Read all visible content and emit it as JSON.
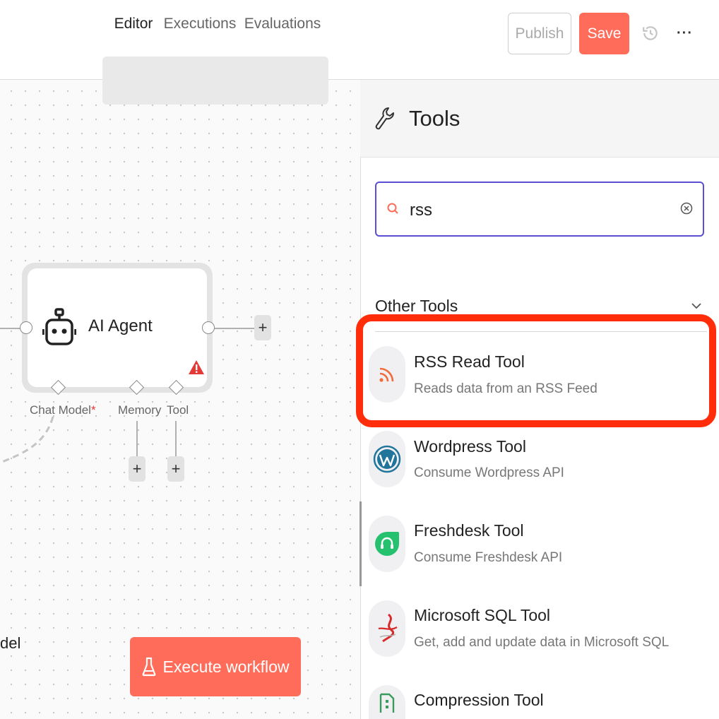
{
  "topbar": {
    "publish_label": "Publish",
    "save_label": "Save",
    "history_icon": "history-icon",
    "more_label": "···"
  },
  "tabs": [
    {
      "label": "Editor",
      "active": true
    },
    {
      "label": "Executions",
      "active": false
    },
    {
      "label": "Evaluations",
      "active": false
    }
  ],
  "canvas": {
    "node": {
      "title": "AI Agent",
      "icon": "robot-icon",
      "warning_icon": "warning-icon"
    },
    "connections": [
      {
        "label": "Chat Model",
        "required_mark": "*"
      },
      {
        "label": "Memory"
      },
      {
        "label": "Tool"
      }
    ],
    "add_label": "+",
    "partial_label": "del",
    "execute_label": "Execute workflow",
    "execute_icon": "flask-icon"
  },
  "panel": {
    "title": "Tools",
    "icon": "wrench-icon",
    "search": {
      "value": "rss",
      "placeholder": ""
    },
    "section_title": "Other Tools",
    "items": [
      {
        "name": "RSS Read Tool",
        "desc": "Reads data from an RSS Feed",
        "icon": "rss-icon",
        "color": "#f26b3a",
        "highlighted": true
      },
      {
        "name": "Wordpress Tool",
        "desc": "Consume Wordpress API",
        "icon": "wordpress-icon",
        "color": "#21759b"
      },
      {
        "name": "Freshdesk Tool",
        "desc": "Consume Freshdesk API",
        "icon": "freshdesk-icon",
        "color": "#25c16f"
      },
      {
        "name": "Microsoft SQL Tool",
        "desc": "Get, add and update data in Microsoft SQL",
        "icon": "mssql-icon",
        "color": "#d62b2b"
      },
      {
        "name": "Compression Tool",
        "desc": "",
        "icon": "compression-icon",
        "color": "#3a9b5c"
      }
    ]
  },
  "colors": {
    "accent": "#ff6d5a",
    "focus": "#5b4fd1",
    "highlight": "#ff2d0a"
  }
}
